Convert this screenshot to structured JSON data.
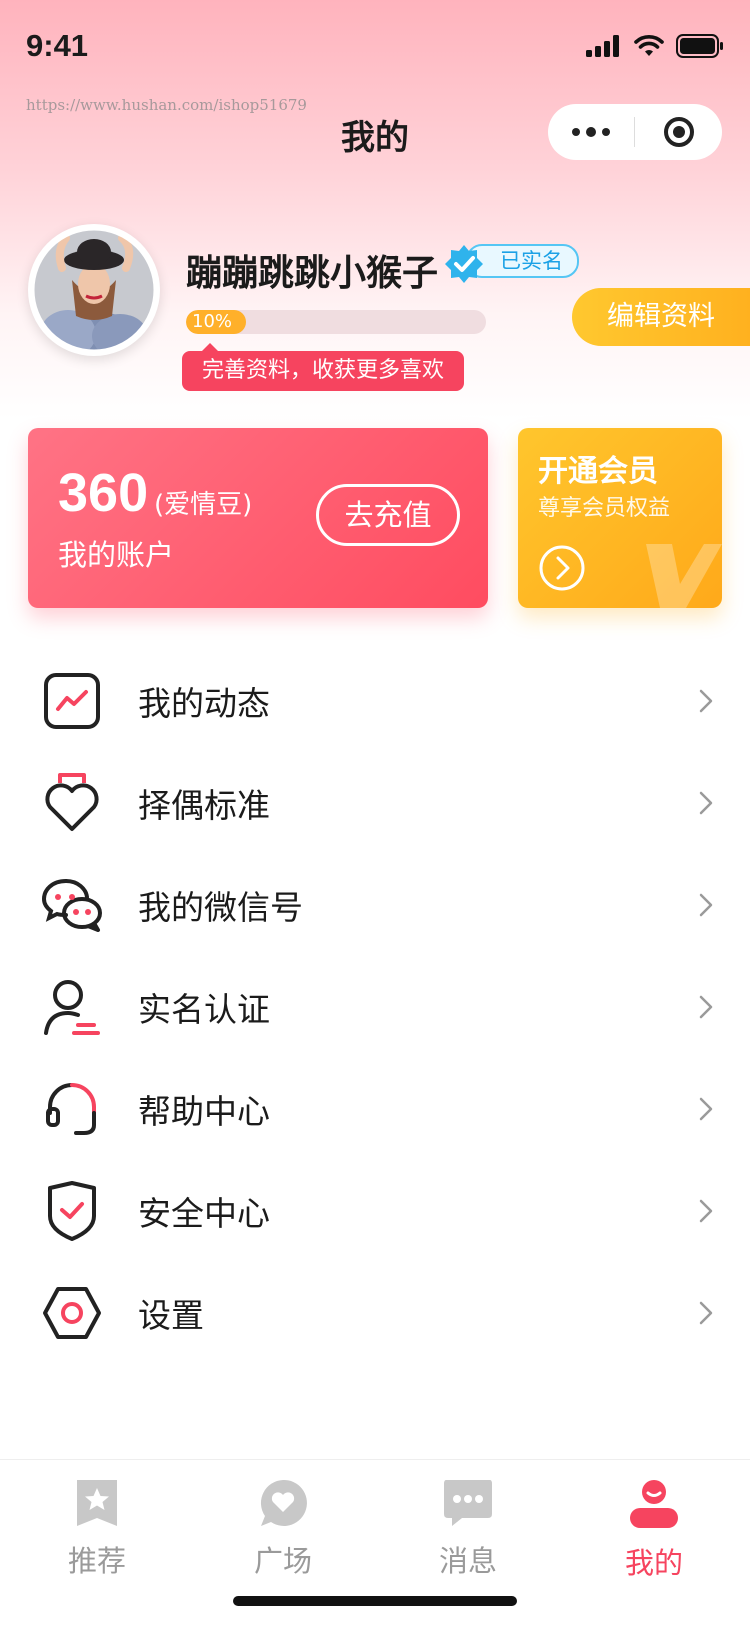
{
  "status_bar": {
    "time": "9:41"
  },
  "watermark": "https://www.hushan.com/ishop51679",
  "nav": {
    "title": "我的",
    "more_icon": "more-dots-icon",
    "close_icon": "target-circle-icon"
  },
  "profile": {
    "username": "蹦蹦跳跳小猴子",
    "verified_label": "已实名",
    "progress_percent": 10,
    "progress_text": "10%",
    "tip": "完善资料，收获更多喜欢",
    "edit_button": "编辑资料"
  },
  "account": {
    "amount": "360",
    "unit": "(爱情豆)",
    "label": "我的账户",
    "recharge_button": "去充值"
  },
  "vip": {
    "title": "开通会员",
    "subtitle": "尊享会员权益"
  },
  "menu": [
    {
      "label": "我的动态",
      "icon": "activity-chart-icon"
    },
    {
      "label": "择偶标准",
      "icon": "heart-standard-icon"
    },
    {
      "label": "我的微信号",
      "icon": "wechat-icon"
    },
    {
      "label": "实名认证",
      "icon": "user-verify-icon"
    },
    {
      "label": "帮助中心",
      "icon": "headset-icon"
    },
    {
      "label": "安全中心",
      "icon": "shield-check-icon"
    },
    {
      "label": "设置",
      "icon": "settings-hexagon-icon"
    }
  ],
  "tabs": [
    {
      "label": "推荐",
      "icon": "star-bookmark-icon",
      "active": false
    },
    {
      "label": "广场",
      "icon": "heart-bubble-icon",
      "active": false
    },
    {
      "label": "消息",
      "icon": "chat-bubble-icon",
      "active": false
    },
    {
      "label": "我的",
      "icon": "profile-icon",
      "active": true
    }
  ],
  "colors": {
    "accent": "#f6445f",
    "gold": "#ffb11f",
    "verify_blue": "#1ba1e6"
  }
}
